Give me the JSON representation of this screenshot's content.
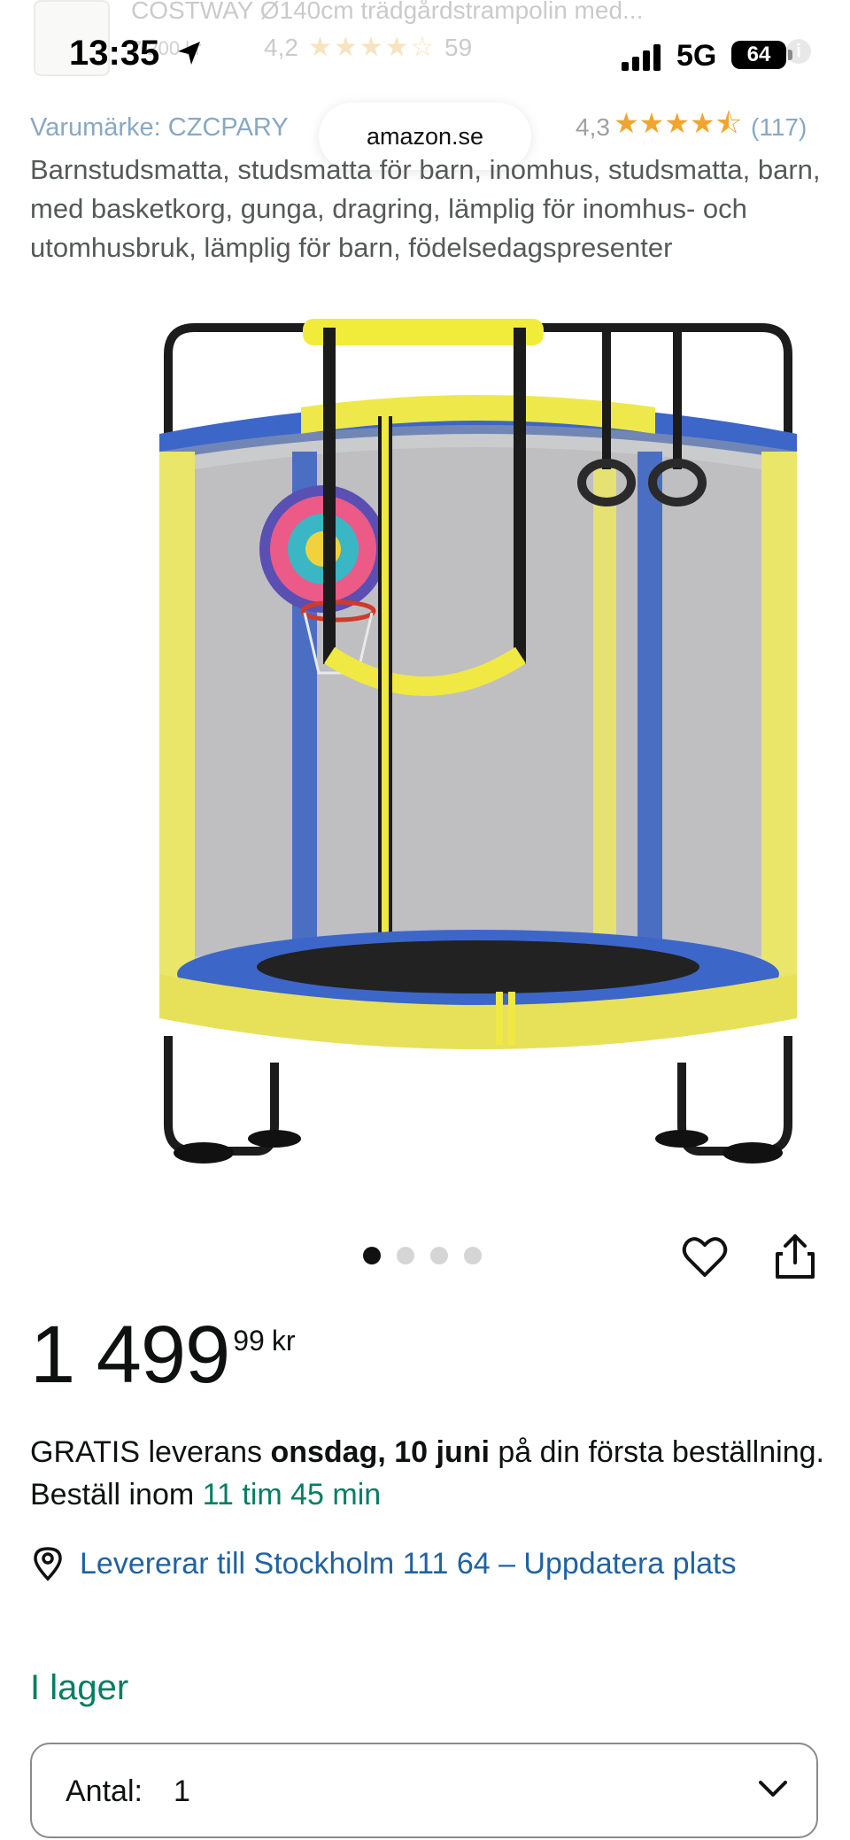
{
  "sticky_header": {
    "title": "COSTWAY Ø140cm trädgårdstrampolin med...",
    "price": "7 200 kr",
    "rating": "4,2",
    "stars": "★★★★☆",
    "review_count": "59",
    "info_icon": "info-icon"
  },
  "status_bar": {
    "time": "13:35",
    "network": "5G",
    "battery": "64",
    "icons": [
      "location-arrow-icon",
      "signal-bars-icon",
      "battery-icon"
    ]
  },
  "browser": {
    "domain": "amazon.se"
  },
  "product": {
    "brand_link": "Varumärke: CZCPARY",
    "rating": "4,3",
    "stars": "★★★★⯪",
    "review_count": "(117)",
    "title": "Barnstudsmatta, studsmatta för barn, inomhus, studsmatta, barn, med basketkorg, gunga, dragring, lämplig för inomhus- och utomhusbruk, lämplig för barn, födelsedagspresenter",
    "image_alt": "trampoline-image",
    "carousel": {
      "count": 4,
      "active_index": 0
    },
    "actions": [
      "heart-icon",
      "share-icon"
    ]
  },
  "price": {
    "whole": "1 499",
    "fraction": "99",
    "currency": "kr"
  },
  "delivery": {
    "prefix": "GRATIS leverans ",
    "date": "onsdag, 10 juni",
    "middle": " på din första beställning. Beställ inom ",
    "countdown": "11 tim 45 min"
  },
  "location": {
    "icon": "location-pin-icon",
    "text": "Levererar till Stockholm 111 64 – Uppdatera plats"
  },
  "stock": {
    "status": "I lager"
  },
  "quantity": {
    "label": "Antal:",
    "value": "1",
    "icon": "chevron-down-icon"
  },
  "colors": {
    "link": "#2162a1",
    "brand_link_faded": "#88a8c4",
    "in_stock_green": "#067d62",
    "star_orange": "#f0a52e",
    "trampoline_yellow": "#e6e373",
    "trampoline_blue": "#4a73c6"
  }
}
